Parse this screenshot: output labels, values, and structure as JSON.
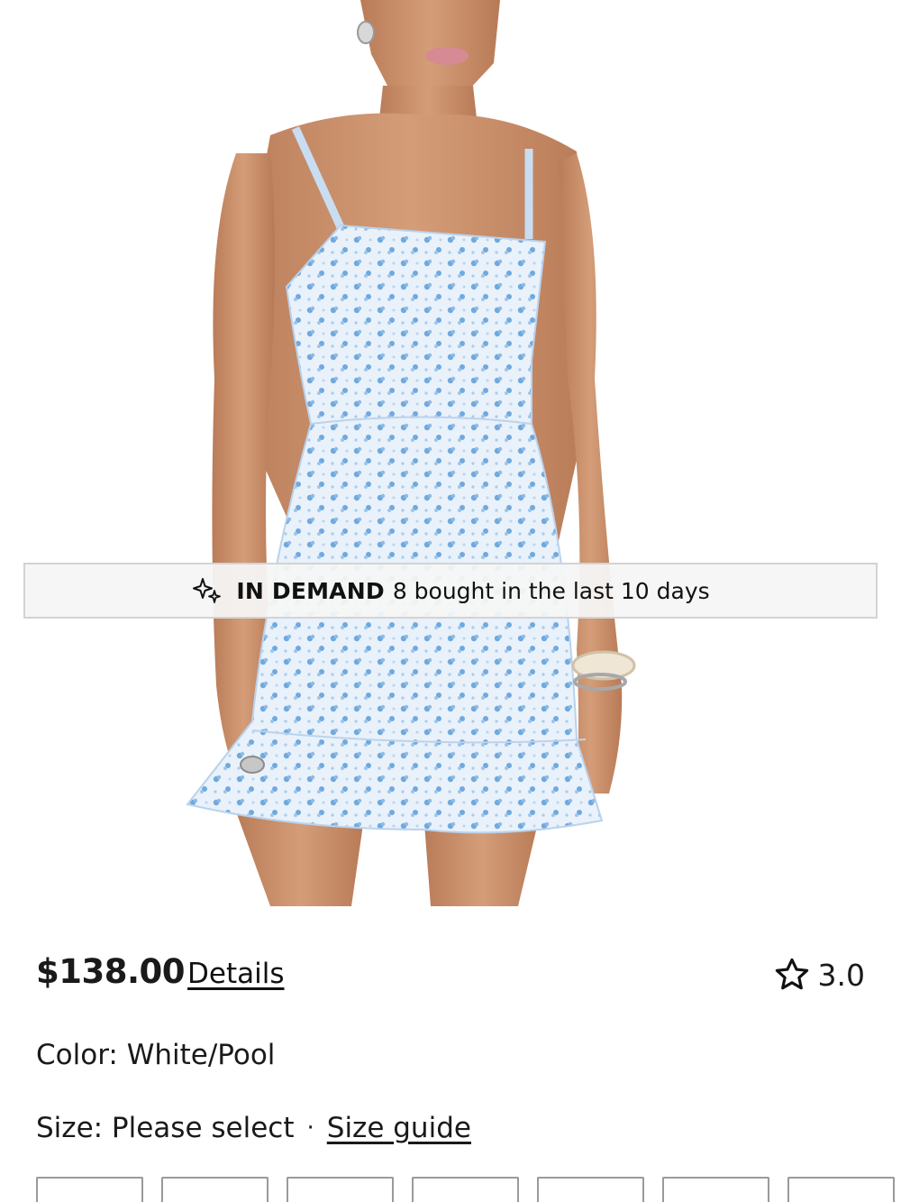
{
  "product": {
    "image_alt": "White/Pool floral mini dress on model",
    "banner": {
      "icon": "sparkle-icon",
      "label": "IN DEMAND",
      "text": "8 bought in the last 10 days"
    },
    "price": "$138.00",
    "details_label": "Details",
    "rating": {
      "icon": "star-outline-icon",
      "value": "3.0"
    },
    "color_line": "Color: White/Pool",
    "size": {
      "prefix": "Size: Please select",
      "separator": "·",
      "guide_label": "Size guide"
    },
    "size_options_visible": 7
  },
  "colors": {
    "dress": "#c9ddf2",
    "dress_print": "#6fa9de",
    "skin": "#c8906b",
    "banner_bg": "#f5f5f5",
    "text": "#1a1a1a"
  }
}
